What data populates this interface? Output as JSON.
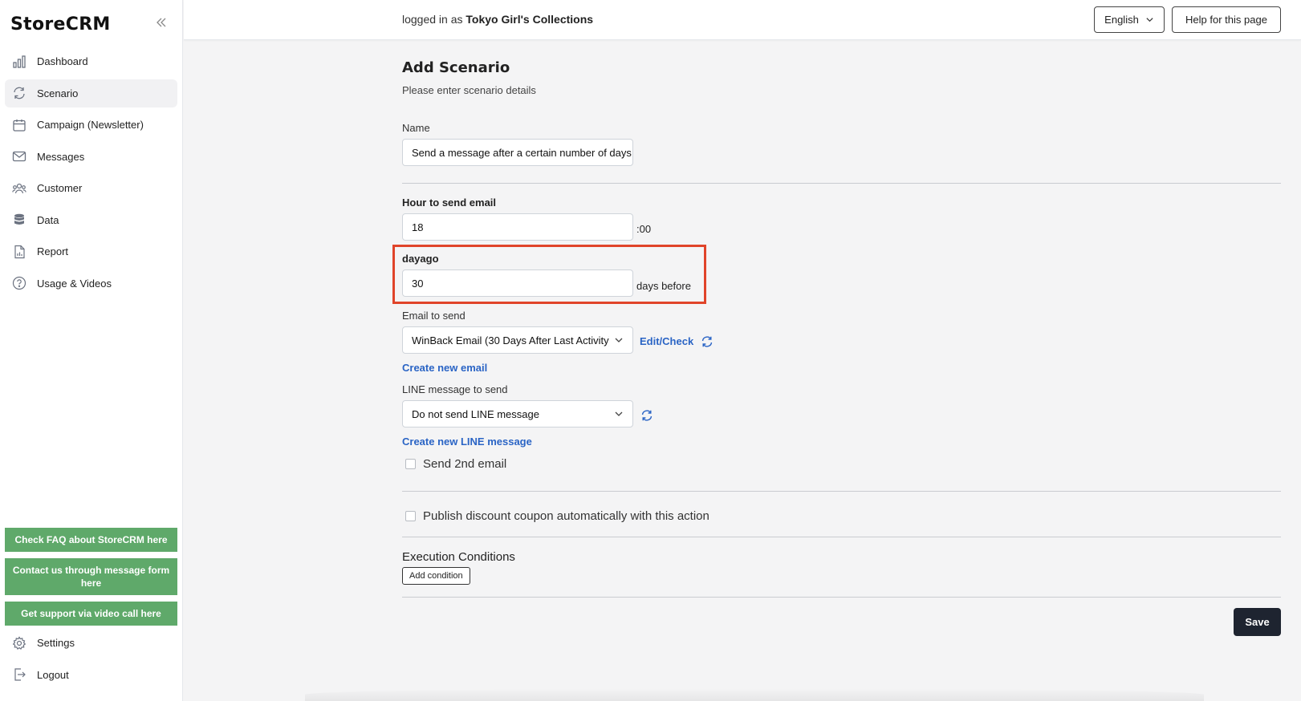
{
  "sidebar": {
    "brand": "StoreCRM",
    "collapse_icon": "chevrons-left-icon",
    "items": [
      {
        "label": "Dashboard",
        "icon": "bar-chart-icon"
      },
      {
        "label": "Scenario",
        "icon": "refresh-icon",
        "active": true
      },
      {
        "label": "Campaign (Newsletter)",
        "icon": "calendar-icon"
      },
      {
        "label": "Messages",
        "icon": "mail-icon"
      },
      {
        "label": "Customer",
        "icon": "users-icon"
      },
      {
        "label": "Data",
        "icon": "database-icon"
      },
      {
        "label": "Report",
        "icon": "document-chart-icon"
      },
      {
        "label": "Usage & Videos",
        "icon": "question-circle-icon"
      }
    ],
    "support_buttons": [
      "Check FAQ about StoreCRM here",
      "Contact us through message form here",
      "Get support via video call here"
    ],
    "bottom_items": [
      {
        "label": "Settings",
        "icon": "gear-icon"
      },
      {
        "label": "Logout",
        "icon": "logout-icon"
      }
    ],
    "support_color": "#5fa96a"
  },
  "header": {
    "logged_in_prefix": "logged in as",
    "store_name": "Tokyo Girl's Collections",
    "language": "English",
    "help_label": "Help for this page"
  },
  "form": {
    "title": "Add Scenario",
    "subtitle": "Please enter scenario details",
    "name_label": "Name",
    "name_value": "Send a message after a certain number of days",
    "hour_label": "Hour to send email",
    "hour_value": "18",
    "hour_suffix": ":00",
    "dayago_label": "dayago",
    "dayago_value": "30",
    "dayago_suffix": "days before",
    "email_label": "Email to send",
    "email_value": "WinBack Email (30 Days After Last Activity)",
    "edit_check": "Edit/Check",
    "create_email": "Create new email",
    "line_label": "LINE message to send",
    "line_value": "Do not send LINE message",
    "create_line": "Create new LINE message",
    "second_email": "Send 2nd email",
    "coupon": "Publish discount coupon automatically with this action",
    "conditions_title": "Execution Conditions",
    "add_condition": "Add condition",
    "save": "Save"
  },
  "colors": {
    "accent_link": "#2a64c5",
    "highlight": "#e0442a",
    "save_bg": "#1e2430"
  }
}
